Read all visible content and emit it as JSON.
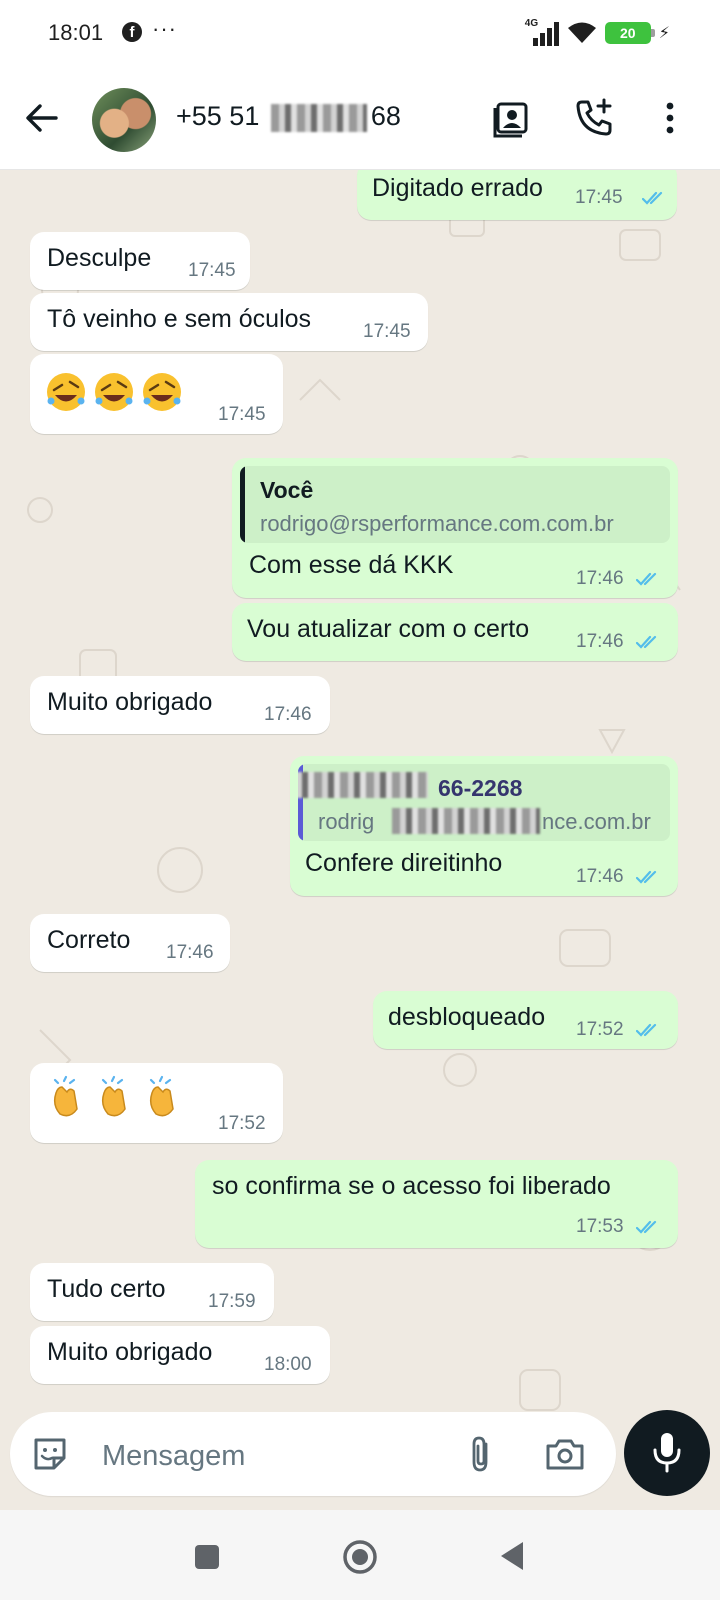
{
  "status_bar": {
    "time": "18:01",
    "notif_app": "f",
    "more": "···",
    "network": "4G",
    "battery": "20"
  },
  "header": {
    "name_prefix": "+55 51",
    "name_suffix": "68"
  },
  "messages": [
    {
      "dir": "out",
      "text": "Digitado errado",
      "time": "17:45"
    },
    {
      "dir": "in",
      "text": "Desculpe",
      "time": "17:45"
    },
    {
      "dir": "in",
      "text": "Tô veinho e sem óculos",
      "time": "17:45"
    },
    {
      "dir": "in",
      "emoji": "rolling-on-floor-laughing",
      "count": 3,
      "time": "17:45"
    },
    {
      "dir": "out",
      "quote_author": "Você",
      "quote_text": "rodrigo@rsperformance.com.com.br",
      "text": "Com esse dá KKK",
      "time": "17:46"
    },
    {
      "dir": "out",
      "text": "Vou atualizar com o certo",
      "time": "17:46"
    },
    {
      "dir": "in",
      "text": "Muito obrigado",
      "time": "17:46"
    },
    {
      "dir": "out",
      "quote_author_visible": "66-2268",
      "quote_text_start": "rodrig",
      "quote_text_end": "nce.com.br",
      "text": "Confere direitinho",
      "time": "17:46"
    },
    {
      "dir": "in",
      "text": "Correto",
      "time": "17:46"
    },
    {
      "dir": "out",
      "text": "desbloqueado",
      "time": "17:52"
    },
    {
      "dir": "in",
      "emoji": "clapping-hands",
      "count": 3,
      "time": "17:52"
    },
    {
      "dir": "out",
      "text": "so confirma se o acesso foi liberado",
      "time": "17:53"
    },
    {
      "dir": "in",
      "text": "Tudo certo",
      "time": "17:59"
    },
    {
      "dir": "in",
      "text": "Muito obrigado",
      "time": "18:00"
    }
  ],
  "input": {
    "placeholder": "Mensagem"
  },
  "colors": {
    "chat_bg": "#efeae2",
    "bubble_in": "#ffffff",
    "bubble_out": "#d9fdd3",
    "read_ticks": "#53bdeb",
    "timestamp": "#667781",
    "quote_self_bar": "#111b21",
    "quote_contact_bar": "#5b5bd6",
    "mic_button": "#111b21"
  }
}
